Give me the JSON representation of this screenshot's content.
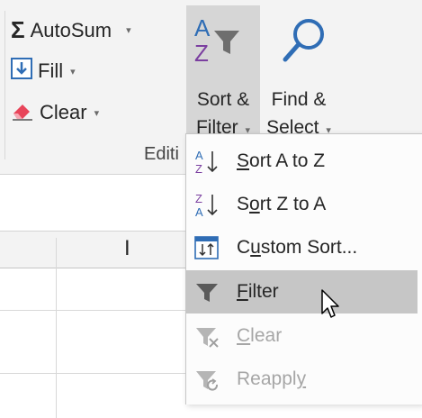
{
  "ribbon": {
    "autosum_label": "AutoSum",
    "fill_label": "Fill",
    "clear_label": "Clear",
    "sort_filter_line1": "Sort &",
    "sort_filter_line2": "Filter",
    "find_select_line1": "Find &",
    "find_select_line2": "Select",
    "group_label": "Editi",
    "caret": "▾"
  },
  "grid": {
    "column_letter": "I"
  },
  "menu": {
    "items": [
      {
        "pre": "",
        "ul": "S",
        "post": "ort A to Z",
        "disabled": false
      },
      {
        "pre": "S",
        "ul": "o",
        "post": "rt Z to A",
        "disabled": false
      },
      {
        "pre": "C",
        "ul": "u",
        "post": "stom Sort...",
        "disabled": false
      },
      {
        "pre": "",
        "ul": "F",
        "post": "ilter",
        "disabled": false
      },
      {
        "pre": "",
        "ul": "C",
        "post": "lear",
        "disabled": true
      },
      {
        "pre": "Reappl",
        "ul": "y",
        "post": "",
        "disabled": true
      }
    ]
  },
  "colors": {
    "ribbon_bg": "#f3f3f3",
    "pressed_button_bg": "#d6d6d6",
    "menu_highlight": "#c6c6c6",
    "accent_blue": "#2f6db5",
    "accent_purple": "#7b3fa0",
    "disabled_text": "#a6a6a6"
  }
}
